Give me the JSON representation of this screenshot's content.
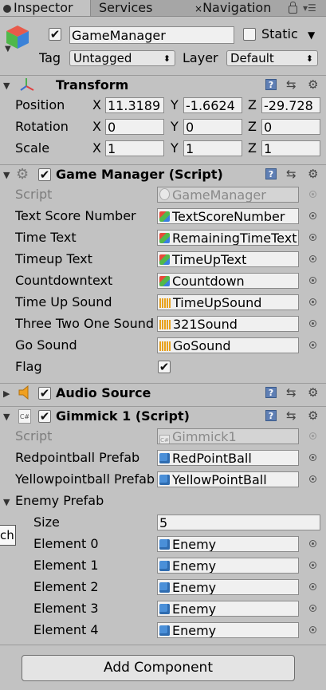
{
  "tabs": {
    "inspector": "Inspector",
    "services": "Services",
    "navigation": "Navigation"
  },
  "gameobject": {
    "name": "GameManager",
    "static_label": "Static",
    "tag_label": "Tag",
    "tag_value": "Untagged",
    "layer_label": "Layer",
    "layer_value": "Default"
  },
  "transform": {
    "title": "Transform",
    "position_label": "Position",
    "rotation_label": "Rotation",
    "scale_label": "Scale",
    "x_label": "X",
    "y_label": "Y",
    "z_label": "Z",
    "position": {
      "x": "11.3189",
      "y": "-1.6624",
      "z": "-29.728"
    },
    "rotation": {
      "x": "0",
      "y": "0",
      "z": "0"
    },
    "scale": {
      "x": "1",
      "y": "1",
      "z": "1"
    }
  },
  "game_manager": {
    "title": "Game Manager (Script)",
    "rows": [
      {
        "label": "Script",
        "value": "GameManager"
      },
      {
        "label": "Text Score Number",
        "value": "TextScoreNumber"
      },
      {
        "label": "Time Text",
        "value": "RemainingTimeText"
      },
      {
        "label": "Timeup Text",
        "value": "TimeUpText"
      },
      {
        "label": "Countdowntext",
        "value": "Countdown"
      },
      {
        "label": "Time Up Sound",
        "value": "TimeUpSound"
      },
      {
        "label": "Three Two One Sound",
        "value": "321Sound"
      },
      {
        "label": "Go Sound",
        "value": "GoSound"
      },
      {
        "label": "Flag",
        "value": "✔"
      }
    ]
  },
  "audio_source": {
    "title": "Audio Source"
  },
  "gimmick": {
    "title": "Gimmick 1 (Script)",
    "script_label": "Script",
    "script_value": "Gimmick1",
    "red_label": "Redpointball Prefab",
    "red_value": "RedPointBall",
    "yellow_label": "Yellowpointball Prefab",
    "yellow_value": "YellowPointBall",
    "enemy_label": "Enemy Prefab",
    "size_label": "Size",
    "size_value": "5",
    "elements": [
      {
        "label": "Element 0",
        "value": "Enemy"
      },
      {
        "label": "Element 1",
        "value": "Enemy"
      },
      {
        "label": "Element 2",
        "value": "Enemy"
      },
      {
        "label": "Element 3",
        "value": "Enemy"
      },
      {
        "label": "Element 4",
        "value": "Enemy"
      }
    ],
    "tooltip": "ch"
  },
  "add_component": "Add Component"
}
